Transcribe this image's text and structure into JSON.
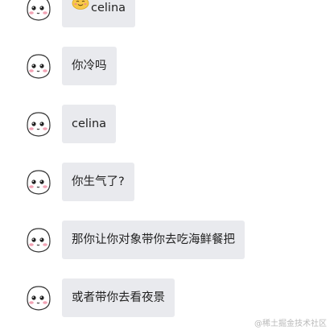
{
  "messages": [
    {
      "text": "celina",
      "emoji": "smiling-face-icon"
    },
    {
      "text": "你冷吗"
    },
    {
      "text": "celina"
    },
    {
      "text": "你生气了?"
    },
    {
      "text": "那你让你对象带你去吃海鲜餐把"
    },
    {
      "text": "或者带你去看夜景"
    }
  ],
  "watermark": "@稀土掘金技术社区",
  "colors": {
    "bubble": "#e9eaee",
    "text": "#222222",
    "cheek": "#f3a3b5"
  }
}
